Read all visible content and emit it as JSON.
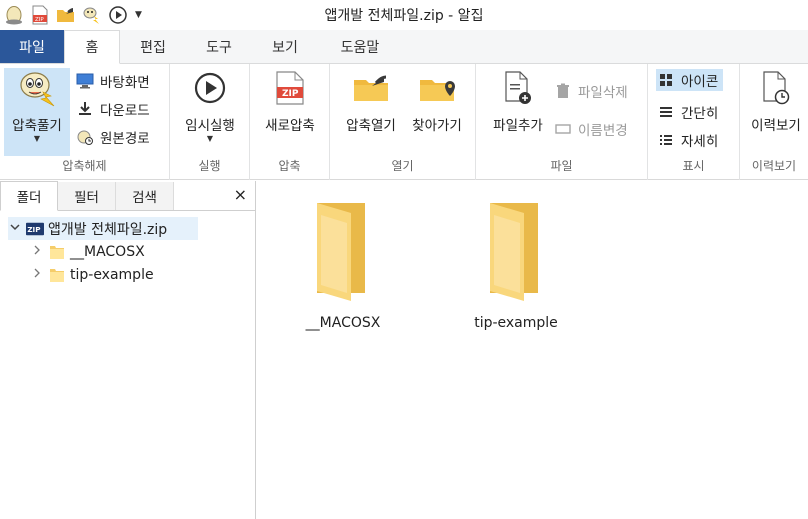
{
  "window": {
    "title": "앱개발 전체파일.zip - 알집"
  },
  "quick_access": {
    "icons": [
      "alzip-egg-icon",
      "zip-file-icon",
      "open-folder-icon",
      "extract-icon",
      "play-icon",
      "customize-dropdown-icon"
    ]
  },
  "tabs": {
    "file": "파일",
    "items": [
      "홈",
      "편집",
      "도구",
      "보기",
      "도움말"
    ],
    "active": "홈"
  },
  "ribbon": {
    "extract": {
      "big_label": "압축풀기",
      "desktop": "바탕화면",
      "downloads": "다운로드",
      "original_path": "원본경로",
      "group": "압축해제"
    },
    "run": {
      "big_label": "임시실행",
      "group": "실행"
    },
    "compress": {
      "big_label": "새로압축",
      "group": "압축"
    },
    "open": {
      "open_archive": "압축열기",
      "find": "찾아가기",
      "group": "열기"
    },
    "file": {
      "add_file": "파일추가",
      "delete_file": "파일삭제",
      "rename": "이름변경",
      "group": "파일"
    },
    "view": {
      "icons": "아이콘",
      "simple": "간단히",
      "details": "자세히",
      "group": "표시"
    },
    "history": {
      "big_label": "이력보기",
      "group": "이력보기"
    }
  },
  "panel": {
    "tabs": [
      "폴더",
      "필터",
      "검색"
    ],
    "close": "×",
    "tree": {
      "root": "앱개발 전체파일.zip",
      "root_badge": "ZIP",
      "children": [
        "__MACOSX",
        "tip-example"
      ]
    }
  },
  "content": {
    "items": [
      "__MACOSX",
      "tip-example"
    ]
  },
  "colors": {
    "file_tab": "#2b579a",
    "selection": "#cde4f7",
    "folder": "#f5cd6a"
  }
}
